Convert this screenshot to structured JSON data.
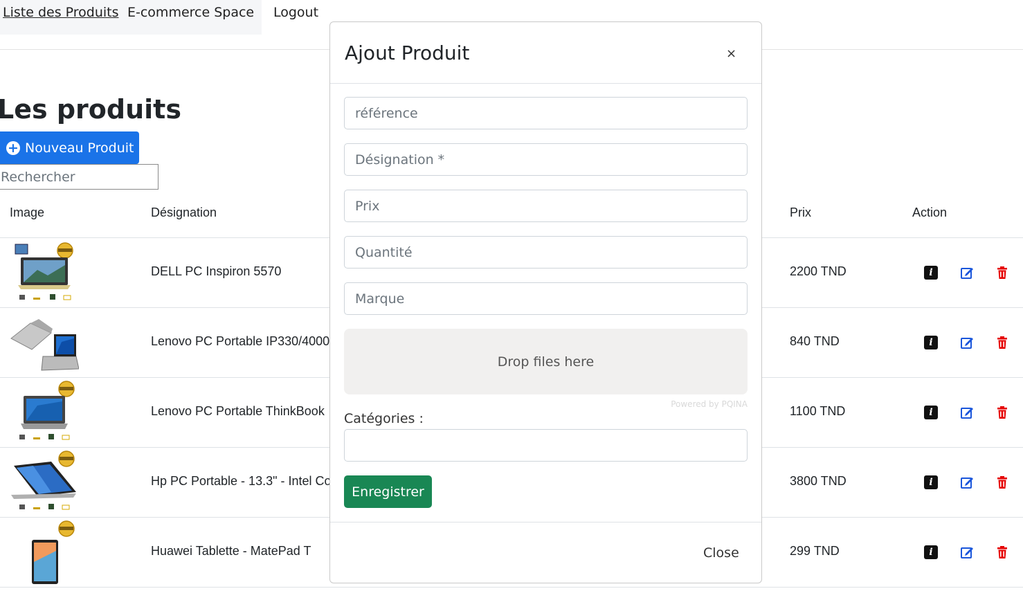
{
  "nav": {
    "items": [
      "Liste des Produits",
      "E-commerce Space",
      "Logout"
    ]
  },
  "page": {
    "title": "Les produits",
    "new_button": "Nouveau Produit",
    "search_placeholder": "Rechercher"
  },
  "table": {
    "headers": {
      "image": "Image",
      "designation": "Désignation",
      "prix": "Prix",
      "action": "Action"
    },
    "rows": [
      {
        "designation": "DELL PC Inspiron 5570",
        "prix": "2200 TND",
        "image": "laptop-dell-thumbnail"
      },
      {
        "designation": "Lenovo PC Portable IP330/4000",
        "prix": "840 TND",
        "image": "laptop-lenovo-thumbnail"
      },
      {
        "designation": "Lenovo PC Portable ThinkBook ·",
        "prix": "1100 TND",
        "image": "laptop-thinkbook-thumbnail"
      },
      {
        "designation": "Hp PC Portable - 13.3\" - Intel Co",
        "prix": "3800 TND",
        "image": "laptop-hp-thumbnail"
      },
      {
        "designation": "Huawei Tablette - MatePad T",
        "prix": "299 TND",
        "image": "tablet-huawei-thumbnail"
      }
    ],
    "icons": {
      "info": "info-icon",
      "edit": "edit-icon",
      "delete": "trash-icon"
    }
  },
  "modal": {
    "title": "Ajout Produit",
    "close_symbol": "×",
    "fields": {
      "reference": "référence",
      "designation": "Désignation *",
      "prix": "Prix",
      "quantite": "Quantité",
      "marque": "Marque"
    },
    "dropzone": "Drop files here",
    "powered_by": "Powered by PQINA",
    "categories_label": "Catégories :",
    "save_button": "Enregistrer",
    "close_button": "Close"
  },
  "colors": {
    "primary": "#1a73e8",
    "success": "#198754",
    "danger": "#e60000",
    "edit": "#1a56db"
  }
}
